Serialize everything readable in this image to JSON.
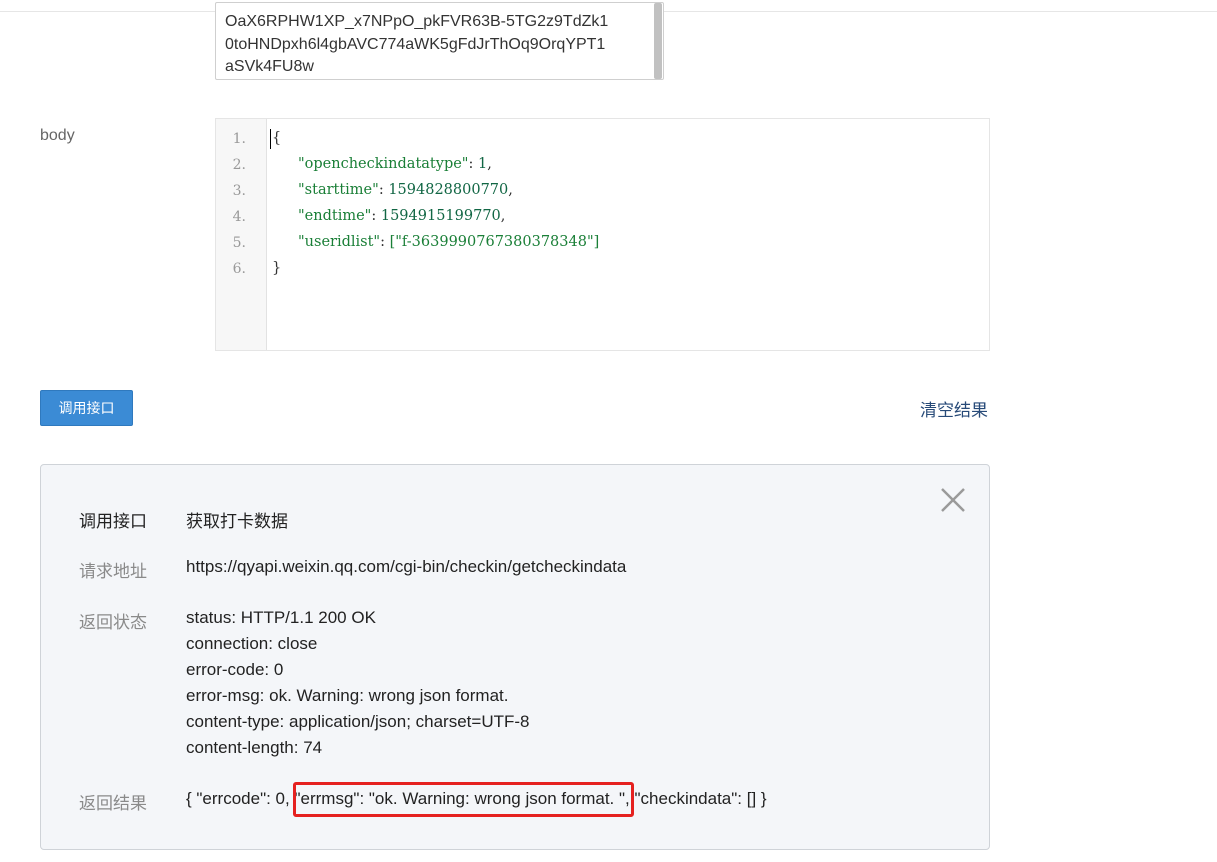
{
  "token_field": {
    "lines": [
      "OaX6RPHW1XP_x7NPpO_pkFVR63B-5TG2z9TdZk1",
      "0toHNDpxh6l4gbAVC774aWK5gFdJrThOq9OrqYPT1",
      "aSVk4FU8w"
    ]
  },
  "body_section": {
    "label": "body",
    "line_numbers": [
      "1.",
      "2.",
      "3.",
      "4.",
      "5.",
      "6."
    ],
    "code": {
      "open": "{",
      "close": "}",
      "key1": "\"opencheckindatatype\"",
      "val1": "1",
      "key2": "\"starttime\"",
      "val2": "1594828800770",
      "key3": "\"endtime\"",
      "val3": "1594915199770",
      "key4": "\"useridlist\"",
      "val4": "[\"f-3639990767380378348\"]",
      "colon": ": ",
      "comma": ","
    }
  },
  "actions": {
    "call_button": "调用接口",
    "clear_link": "清空结果"
  },
  "result": {
    "api_label": "调用接口",
    "api_value": "获取打卡数据",
    "url_label": "请求地址",
    "url_value": "https://qyapi.weixin.qq.com/cgi-bin/checkin/getcheckindata",
    "status_label": "返回状态",
    "status_lines": [
      "status: HTTP/1.1 200 OK",
      "connection: close",
      "error-code: 0",
      "error-msg: ok. Warning: wrong json format.",
      "content-type: application/json; charset=UTF-8",
      "content-length: 74"
    ],
    "result_label": "返回结果",
    "result_part1": "{ \"errcode\": 0,",
    "result_part2": "\"errmsg\": \"ok. Warning: wrong json format.",
    "result_part3": "\", \"checkindata\": [] }"
  },
  "colors": {
    "button": "#3b8bd5",
    "highlight_box": "#e5211f",
    "code_string": "#1a7f37"
  },
  "icons": {
    "close": "close-icon"
  }
}
